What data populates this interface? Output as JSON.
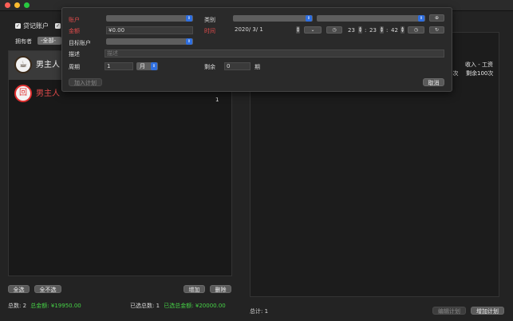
{
  "toolbar": {
    "filter_checkbox_label": "贷记账户",
    "owner_label": "拥有者",
    "owner_select_value": "-全部-"
  },
  "accounts": [
    {
      "name": "男主人",
      "avatar_glyph": "☕",
      "value": ""
    },
    {
      "name": "男主人",
      "avatar_glyph": "回",
      "value": "1"
    }
  ],
  "left_actions": {
    "select_all": "全选",
    "select_none": "全不选",
    "add": "增加",
    "delete": "删除"
  },
  "left_footer": {
    "total_count_label": "总数:",
    "total_count": "2",
    "total_amount_label": "总金额:",
    "total_amount": "¥19950.00",
    "selected_count_label": "已选总数:",
    "selected_count": "1",
    "selected_amount_label": "已选总金额:",
    "selected_amount": "¥20000.00"
  },
  "right_panel": {
    "row1": "收入 - 工资",
    "row2_left": "-次",
    "row2_right": "剩余100次",
    "footer_total_label": "总计:",
    "footer_total": "1",
    "edit_plan": "编辑计划",
    "add_plan": "增加计划"
  },
  "popup": {
    "account_label": "账户",
    "amount_label": "金额",
    "amount_value": "¥0.00",
    "target_account_label": "目标账户",
    "category_label": "类别",
    "time_label": "时间",
    "date_value": "2020/ 3/ 1",
    "hour": "23",
    "minute": "23",
    "second": "42",
    "description_label": "描述",
    "description_placeholder": "描述",
    "period_label": "周期",
    "period_value": "1",
    "period_unit": "月",
    "remaining_label": "剩余",
    "remaining_value": "0",
    "remaining_unit": "期",
    "join_plan": "加入计划",
    "cancel": "取消"
  },
  "colors": {
    "accent_blue": "#2f6fe0",
    "label_red": "#e24b4b",
    "amount_green": "#46d246"
  }
}
